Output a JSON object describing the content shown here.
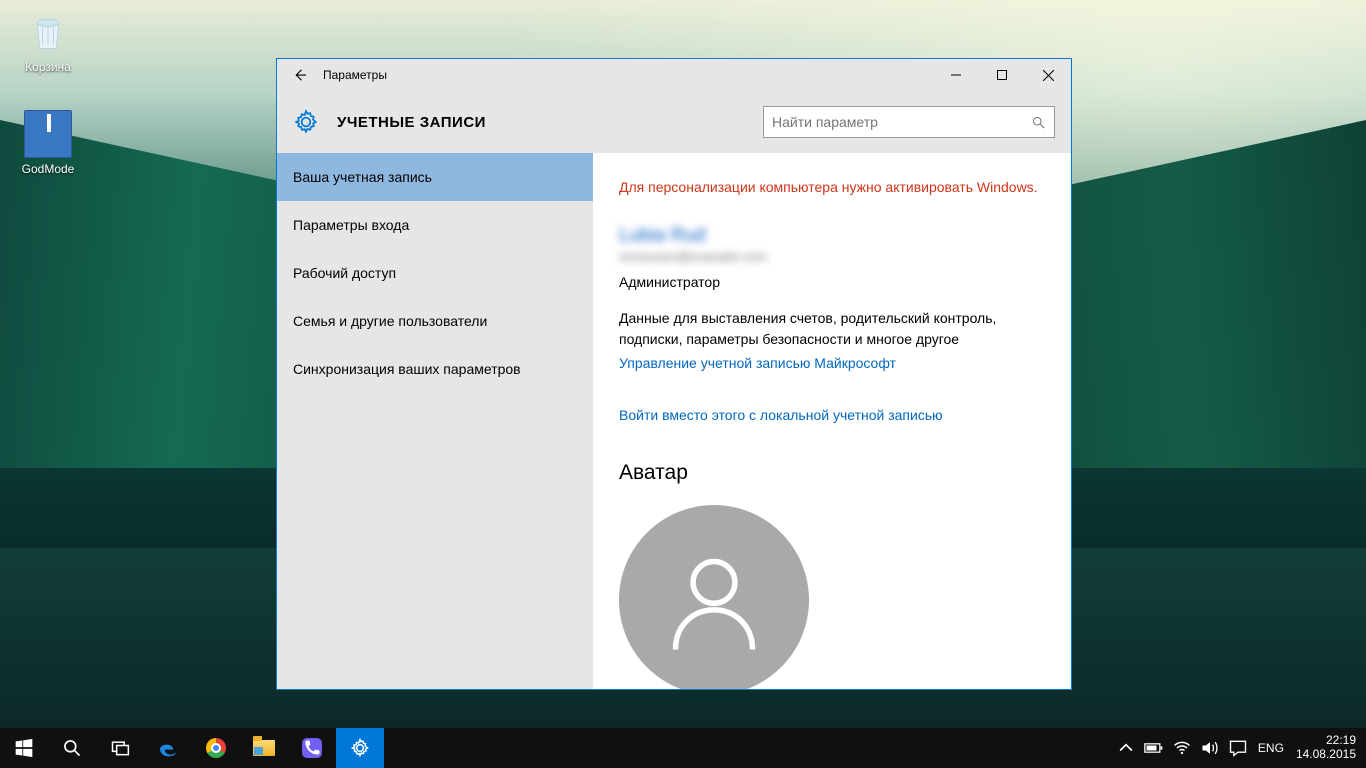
{
  "desktop": {
    "icons": [
      {
        "name": "recycle-bin",
        "label": "Корзина"
      },
      {
        "name": "godmode",
        "label": "GodMode"
      }
    ]
  },
  "window": {
    "title": "Параметры",
    "header": "УЧЕТНЫЕ ЗАПИСИ",
    "search_placeholder": "Найти параметр",
    "sidebar": [
      "Ваша учетная запись",
      "Параметры входа",
      "Рабочий доступ",
      "Семья и другие пользователи",
      "Синхронизация ваших параметров"
    ],
    "content": {
      "warning": "Для персонализации компьютера нужно активировать Windows.",
      "user_name": "Lubia Rud",
      "user_email": "someuser@example.com",
      "role": "Администратор",
      "description": "Данные для выставления счетов, родительский контроль, подписки, параметры безопасности и многое другое",
      "manage_link": "Управление учетной записью Майкрософт",
      "local_link": "Войти вместо этого с локальной учетной записью",
      "avatar_heading": "Аватар"
    }
  },
  "taskbar": {
    "lang": "ENG",
    "time": "22:19",
    "date": "14.08.2015"
  }
}
